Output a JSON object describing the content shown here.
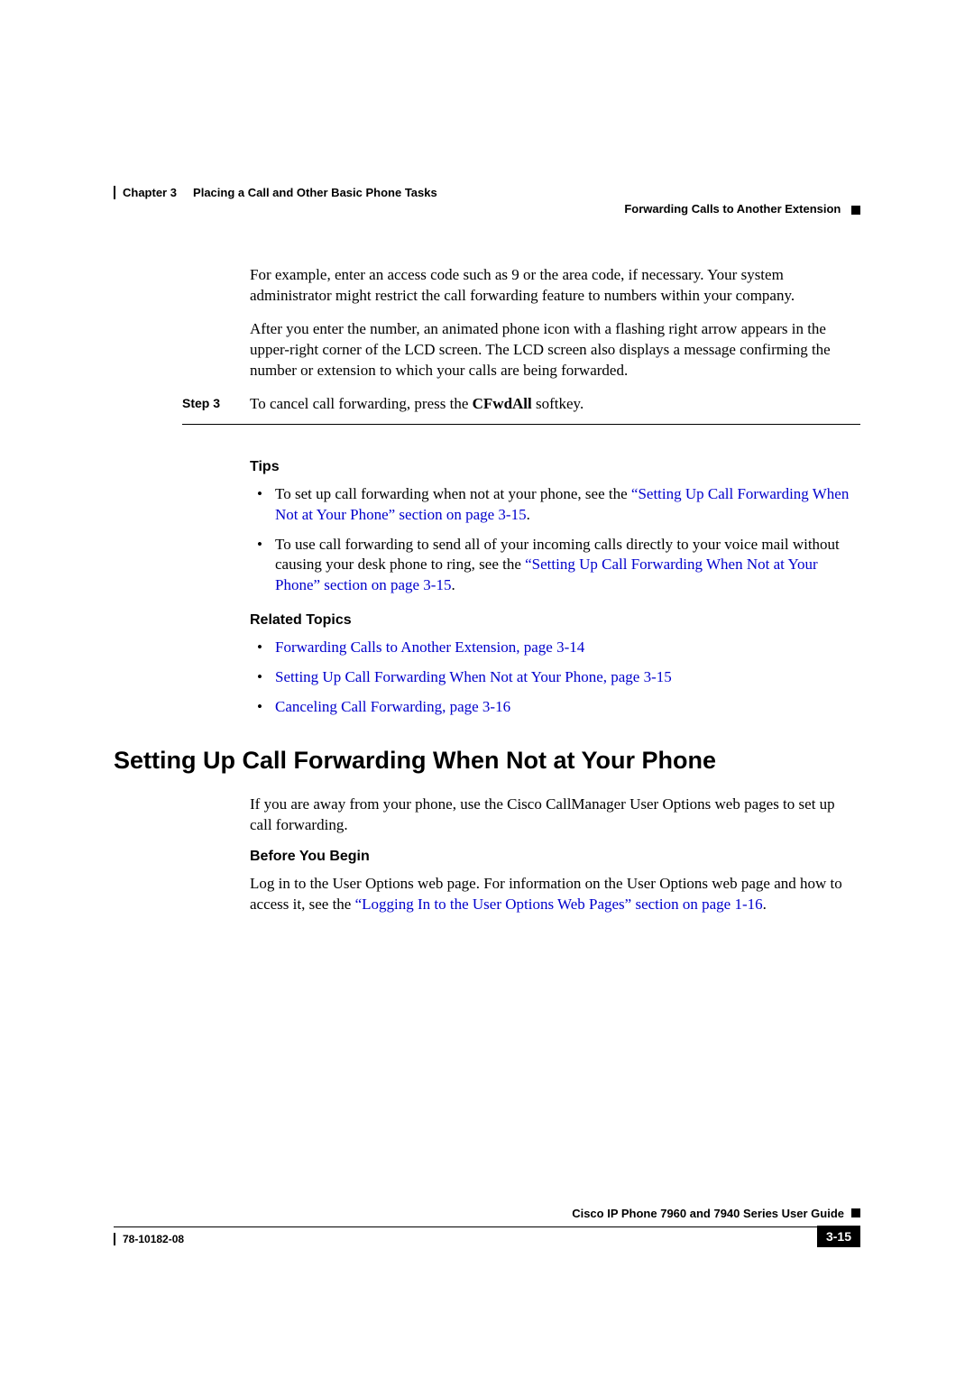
{
  "header": {
    "chapter_label": "Chapter 3",
    "chapter_title": "Placing a Call and Other Basic Phone Tasks",
    "section_title": "Forwarding Calls to Another Extension"
  },
  "body": {
    "para1": "For example, enter an access code such as 9 or the area code, if necessary. Your system administrator might restrict the call forwarding feature to numbers within your company.",
    "para2": "After you enter the number, an animated phone icon with a flashing right arrow appears in the upper-right corner of the LCD screen. The LCD screen also displays a message confirming the number or extension to which your calls are being forwarded.",
    "step3_label": "Step 3",
    "step3_pre": "To cancel call forwarding, press the ",
    "step3_bold": "CFwdAll",
    "step3_post": " softkey.",
    "tips_heading": "Tips",
    "tip1_pre": "To set up call forwarding when not at your phone, see the ",
    "tip1_link": "“Setting Up Call Forwarding When Not at Your Phone” section on page 3-15",
    "tip1_post": ".",
    "tip2_pre": "To use call forwarding to send all of your incoming calls directly to your voice mail without causing your desk phone to ring, see the ",
    "tip2_link": "“Setting Up Call Forwarding When Not at Your Phone” section on page 3-15",
    "tip2_post": ".",
    "related_heading": "Related Topics",
    "rel1": "Forwarding Calls to Another Extension, page 3-14",
    "rel2": "Setting Up Call Forwarding When Not at Your Phone, page 3-15",
    "rel3": "Canceling Call Forwarding, page 3-16",
    "h2": "Setting Up Call Forwarding When Not at Your Phone",
    "para3": "If you are away from your phone, use the Cisco CallManager User Options web pages to set up call forwarding.",
    "before_heading": "Before You Begin",
    "para4_pre": "Log in to the User Options web page. For information on the User Options web page and how to access it, see the ",
    "para4_link": "“Logging In to the User Options Web Pages” section on page 1-16",
    "para4_post": "."
  },
  "footer": {
    "guide_title": "Cisco IP Phone 7960 and 7940 Series User Guide",
    "doc_number": "78-10182-08",
    "page_number": "3-15"
  }
}
